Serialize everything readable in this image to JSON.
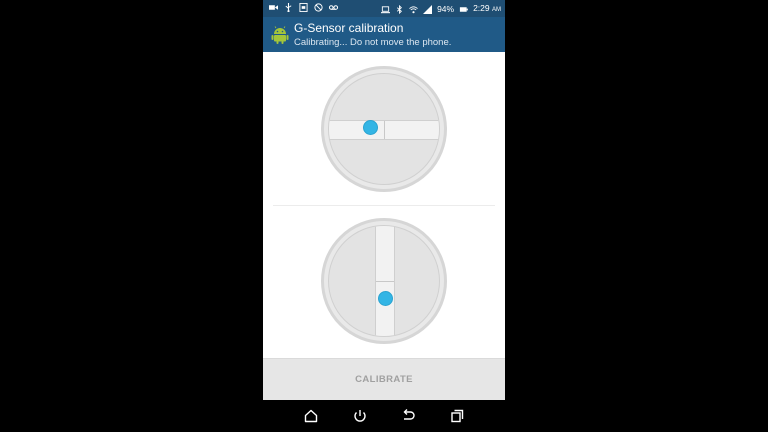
{
  "status_bar": {
    "battery": "94%",
    "time": "2:29",
    "ampm": "AM"
  },
  "app": {
    "title": "G-Sensor calibration",
    "subtitle": "Calibrating...  Do not move the phone."
  },
  "calibrate_button": {
    "label": "CALIBRATE"
  },
  "colors": {
    "status_bar": "#1f4e73",
    "app_bar": "#205a87",
    "bubble": "#33b5e5",
    "button_bg": "#e6e6e6",
    "button_text": "#a0a0a0"
  },
  "icons": {
    "status_left": [
      "video-camera-icon",
      "usb-icon",
      "sim-icon",
      "no-sound-icon",
      "voicemail-icon"
    ],
    "status_right": [
      "laptop-icon",
      "bluetooth-icon",
      "wifi-icon",
      "signal-icon",
      "battery-icon"
    ],
    "nav": [
      "home-icon",
      "power-icon",
      "back-icon",
      "recent-apps-icon"
    ]
  }
}
